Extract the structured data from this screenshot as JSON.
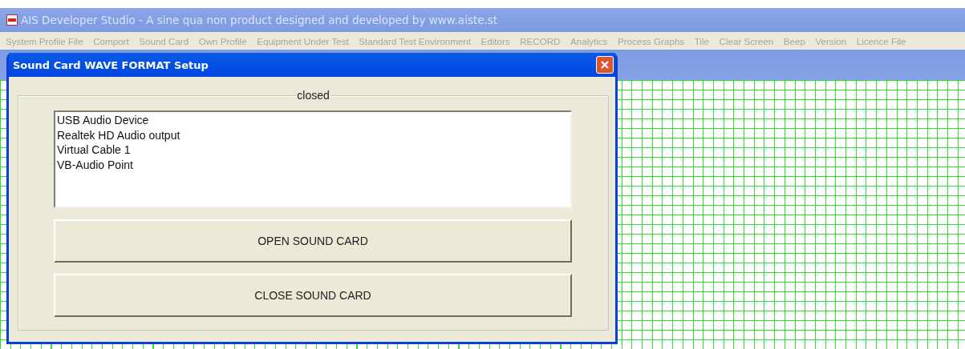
{
  "window": {
    "title": "AIS Developer Studio - A sine qua non product designed and developed by www.aiste.st"
  },
  "menu": [
    "System Profile File",
    "Comport",
    "Sound Card",
    "Own Profile",
    "Equipment Under Test",
    "Standard Test Environment",
    "Editors",
    "RECORD",
    "Analytics",
    "Process Graphs",
    "Tile",
    "Clear Screen",
    "Beep",
    "Version",
    "Licence File"
  ],
  "dialog": {
    "title": "Sound Card WAVE FORMAT Setup",
    "group_label": "closed",
    "devices": [
      {
        "name": "USB Audio Device",
        "selected": false
      },
      {
        "name": "Realtek HD Audio output",
        "selected": false
      },
      {
        "name": "Virtual Cable 1",
        "selected": false
      },
      {
        "name": "VB-Audio Point",
        "selected": false
      }
    ],
    "buttons": [
      "OPEN SOUND CARD",
      "CLOSE SOUND CARD"
    ]
  }
}
